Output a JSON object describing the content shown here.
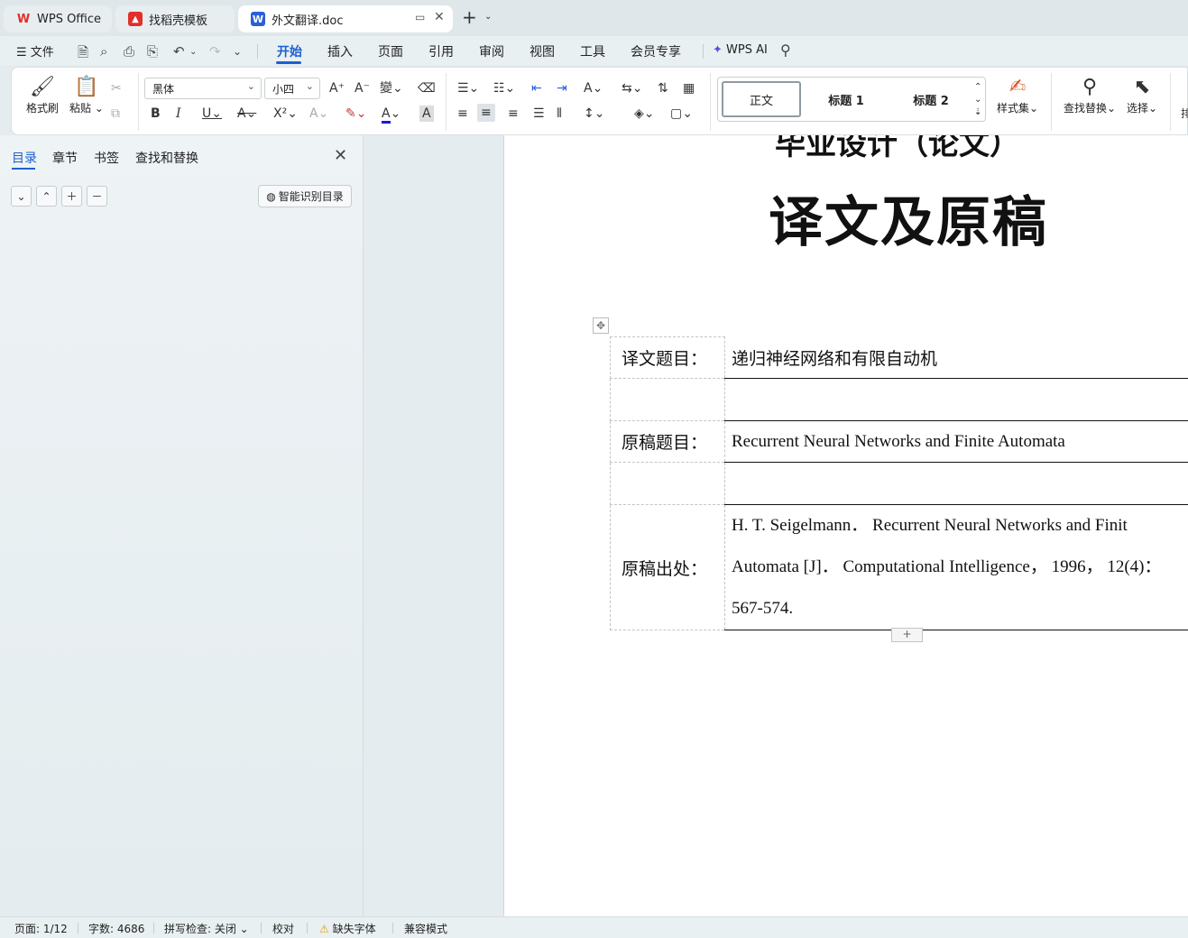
{
  "tabs": [
    {
      "label": "WPS Office",
      "icon": "wps-logo-icon"
    },
    {
      "label": "找稻壳模板",
      "icon": "docer-logo-icon"
    },
    {
      "label": "外文翻译.doc",
      "icon": "word-doc-icon",
      "active": true
    }
  ],
  "menu": {
    "file": "文件",
    "items": [
      "开始",
      "插入",
      "页面",
      "引用",
      "审阅",
      "视图",
      "工具",
      "会员专享"
    ],
    "active": "开始",
    "wps_ai": "WPS AI"
  },
  "ribbon": {
    "format_painter": "格式刷",
    "paste": "粘贴",
    "font": "黑体",
    "font_size": "小四",
    "styles": [
      "正文",
      "标题 1",
      "标题 2"
    ],
    "style_set": "样式集",
    "find_replace": "查找替换",
    "select": "选择",
    "more": "排"
  },
  "nav_panel": {
    "tabs": [
      "目录",
      "章节",
      "书签",
      "查找和替换"
    ],
    "active_tab": "目录",
    "smart_toc": "智能识别目录"
  },
  "document": {
    "heading_top": "毕业设计（论文）",
    "heading_main": "译文及原稿",
    "rows": [
      {
        "label": "译文题目：",
        "value": "递归神经网络和有限自动机"
      },
      {
        "label": "",
        "value": ""
      },
      {
        "label": "原稿题目：",
        "value": "Recurrent Neural Networks and Finite Automata"
      },
      {
        "label": "",
        "value": ""
      },
      {
        "label": "原稿出处：",
        "value_lines": [
          "H. T. Seigelmann． Recurrent Neural Networks and Finit",
          "Automata [J]． Computational Intelligence， 1996， 12(4)：",
          "567-574."
        ]
      }
    ],
    "add_row": "+"
  },
  "status": {
    "page": "页面: 1/12",
    "words": "字数: 4686",
    "spell": "拼写检查: 关闭",
    "proof": "校对",
    "missing_font": "缺失字体",
    "compat": "兼容模式"
  },
  "colors": {
    "accent": "#1d5fd0",
    "wps_red": "#e0302a"
  }
}
